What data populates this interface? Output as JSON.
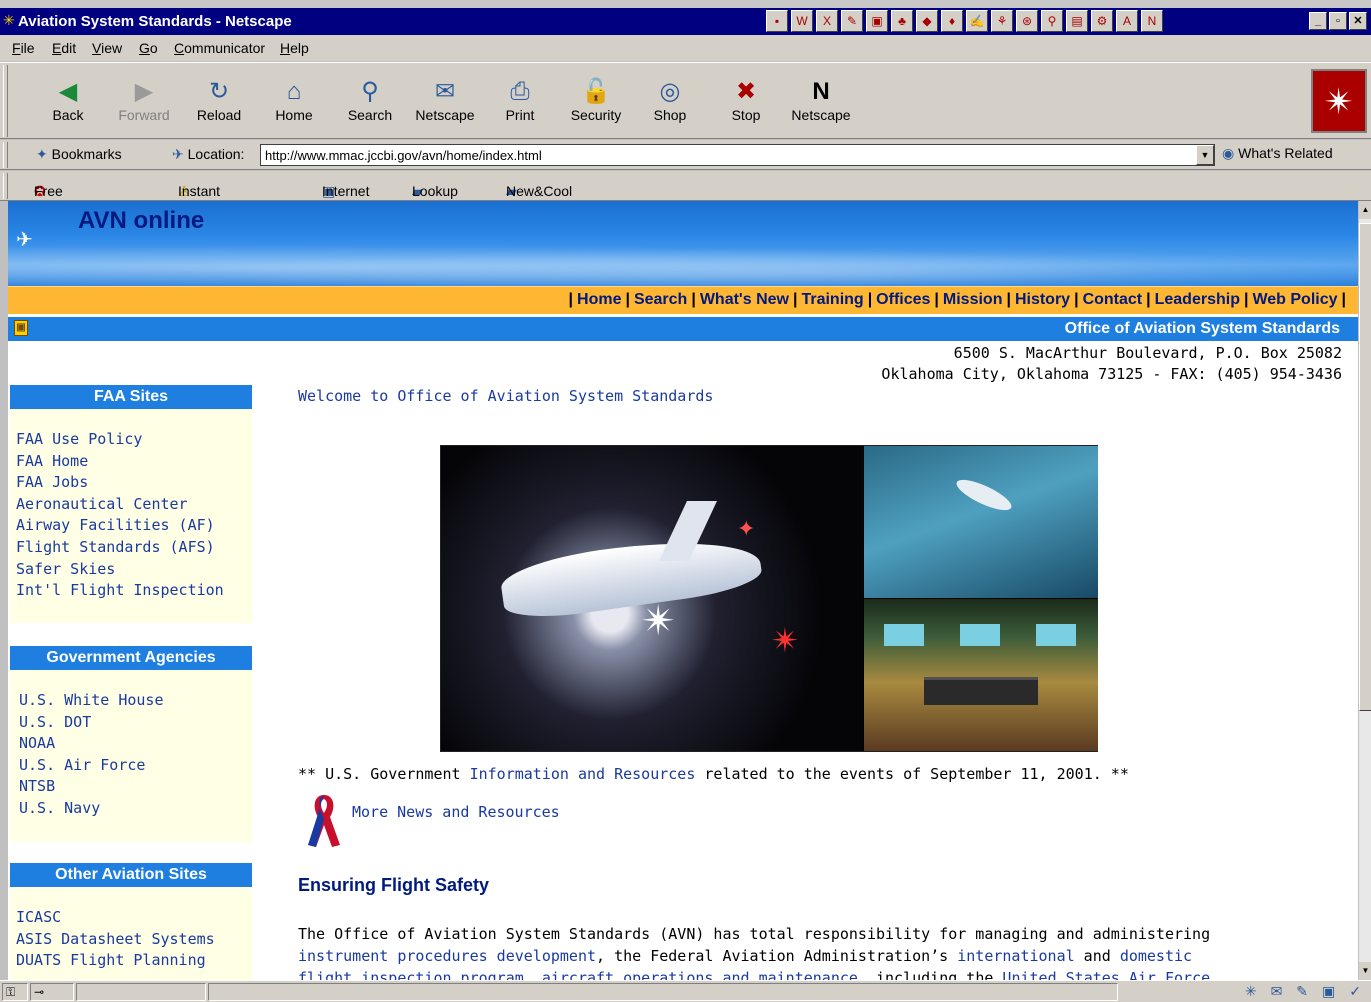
{
  "window": {
    "title": "Aviation System Standards - Netscape"
  },
  "menu": [
    "File",
    "Edit",
    "View",
    "Go",
    "Communicator",
    "Help"
  ],
  "toolbar": [
    {
      "label": "Back",
      "icon": "back-arrow-icon",
      "glyph": "◀"
    },
    {
      "label": "Forward",
      "icon": "forward-arrow-icon",
      "glyph": "▶"
    },
    {
      "label": "Reload",
      "icon": "reload-icon",
      "glyph": "↻"
    },
    {
      "label": "Home",
      "icon": "home-icon",
      "glyph": "⌂"
    },
    {
      "label": "Search",
      "icon": "search-icon",
      "glyph": "⚲"
    },
    {
      "label": "Netscape",
      "icon": "my-netscape-icon",
      "glyph": "✉"
    },
    {
      "label": "Print",
      "icon": "print-icon",
      "glyph": "⎙"
    },
    {
      "label": "Security",
      "icon": "lock-icon",
      "glyph": "🔓"
    },
    {
      "label": "Shop",
      "icon": "shop-icon",
      "glyph": "◎"
    },
    {
      "label": "Stop",
      "icon": "stop-icon",
      "glyph": "✖"
    },
    {
      "label": "Netscape",
      "icon": "netscape-n-icon",
      "glyph": "N"
    }
  ],
  "location": {
    "bookmarks_label": "Bookmarks",
    "location_label": "Location:",
    "url": "http://www.mmac.jccbi.gov/avn/home/index.html",
    "related_label": "What's Related"
  },
  "personal_toolbar": [
    "Free AOL & Unl",
    "Instant Message",
    "Internet",
    "Lookup",
    "New&Cool"
  ],
  "page": {
    "brand": "AVN online",
    "nav_links": [
      "Home",
      "Search",
      "What's New",
      "Training",
      "Offices",
      "Mission",
      "History",
      "Contact",
      "Leadership",
      "Web Policy"
    ],
    "office_title": "Office of Aviation System Standards",
    "address_line1": "6500 S. MacArthur Boulevard, P.O. Box 25082",
    "address_line2": "Oklahoma City, Oklahoma 73125 - FAX: (405) 954-3436",
    "sidebar": [
      {
        "heading": "FAA Sites",
        "items": [
          "FAA Use Policy",
          "FAA Home",
          "FAA Jobs",
          "Aeronautical Center",
          "Airway Facilities (AF)",
          "Flight Standards (AFS)",
          "Safer Skies",
          "Int'l Flight Inspection"
        ]
      },
      {
        "heading": "Government Agencies",
        "items": [
          "U.S. White House",
          "U.S. DOT",
          "NOAA",
          "U.S. Air Force",
          "NTSB",
          "U.S. Navy"
        ]
      },
      {
        "heading": "Other Aviation Sites",
        "items": [
          "ICASC",
          "ASIS Datasheet Systems",
          "DUATS Flight Planning"
        ]
      }
    ],
    "welcome": "Welcome to Office of Aviation System Standards",
    "sept11": {
      "prefix": "** U.S. Government ",
      "link": "Information and Resources",
      "suffix": " related to the events of September 11, 2001. **"
    },
    "more_news": "More News and Resources",
    "section_heading": "Ensuring Flight Safety",
    "para": {
      "t1": "The Office of Aviation System Standards (AVN) has total responsibility for managing and administering",
      "l1": "instrument procedures development",
      "t2": ", the Federal Aviation Administration’s ",
      "l2": "international",
      "t3": " and ",
      "l3": "domestic",
      "l4": "flight inspection program",
      "t4": ", ",
      "l5": "aircraft operations and maintenance",
      "t5": ", including the ",
      "l6": "United States Air Force"
    }
  }
}
